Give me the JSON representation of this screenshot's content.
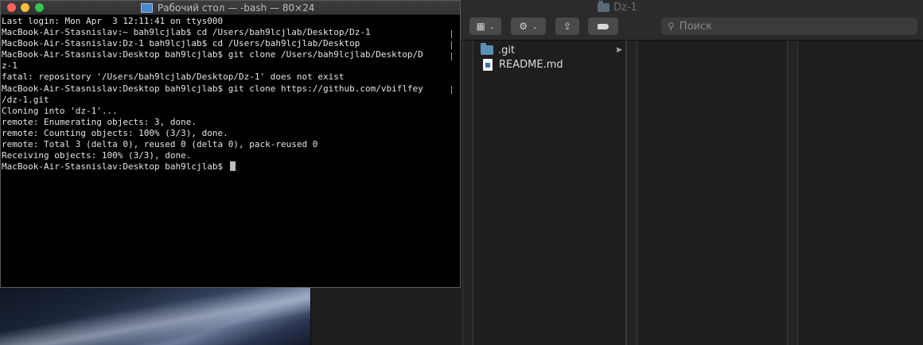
{
  "terminal": {
    "title": "Рабочий стол — -bash — 80×24",
    "lines": [
      "Last login: Mon Apr  3 12:11:41 on ttys000",
      "MacBook-Air-Stasnislav:~ bah9lcjlab$ cd /Users/bah9lcjlab/Desktop/Dz-1",
      "MacBook-Air-Stasnislav:Dz-1 bah9lcjlab$ cd /Users/bah9lcjlab/Desktop",
      "MacBook-Air-Stasnislav:Desktop bah9lcjlab$ git clone /Users/bah9lcjlab/Desktop/D",
      "z-1",
      "fatal: repository '/Users/bah9lcjlab/Desktop/Dz-1' does not exist",
      "MacBook-Air-Stasnislav:Desktop bah9lcjlab$ git clone https://github.com/vbiflfey",
      "/dz-1.git",
      "Cloning into 'dz-1'...",
      "remote: Enumerating objects: 3, done.",
      "remote: Counting objects: 100% (3/3), done.",
      "remote: Total 3 (delta 0), reused 0 (delta 0), pack-reused 0",
      "Receiving objects: 100% (3/3), done.",
      "MacBook-Air-Stasnislav:Desktop bah9lcjlab$ "
    ]
  },
  "finder": {
    "title": "Dz-1",
    "search_placeholder": "Поиск",
    "items": [
      {
        "name": ".git",
        "kind": "folder"
      },
      {
        "name": "README.md",
        "kind": "document"
      }
    ]
  },
  "icons": {
    "view": "grid-view-icon",
    "action": "gear-icon",
    "share": "share-icon",
    "tag": "tag-icon",
    "search": "search-icon"
  }
}
